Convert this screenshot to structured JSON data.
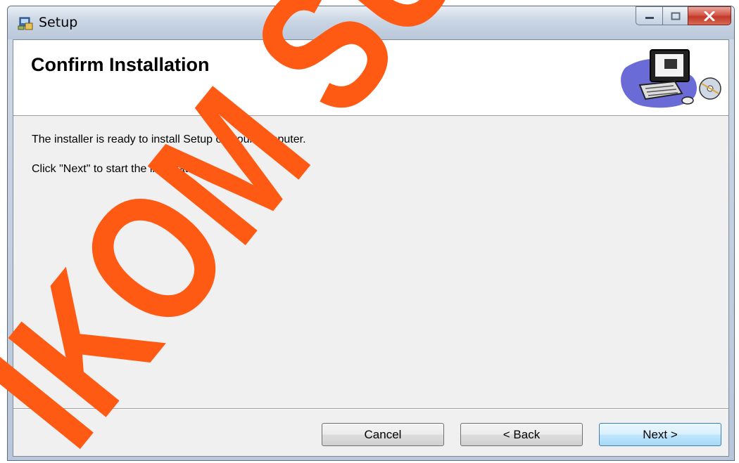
{
  "window": {
    "title": "Setup",
    "controls": [
      "minimize-icon",
      "maximize-icon",
      "close-icon"
    ]
  },
  "header": {
    "title": "Confirm Installation",
    "graphic": "computer-setup-icon"
  },
  "body": {
    "line1": "The installer is ready to install Setup on your computer.",
    "line2": "Click \"Next\" to start the installation."
  },
  "buttons": {
    "cancel": "Cancel",
    "back": "< Back",
    "next": "Next >"
  },
  "watermark": {
    "text": "IKOM SUR",
    "color": "#ff5a14"
  },
  "colors": {
    "close_button": "#c2392a",
    "default_button_border": "#3c7fb1"
  }
}
